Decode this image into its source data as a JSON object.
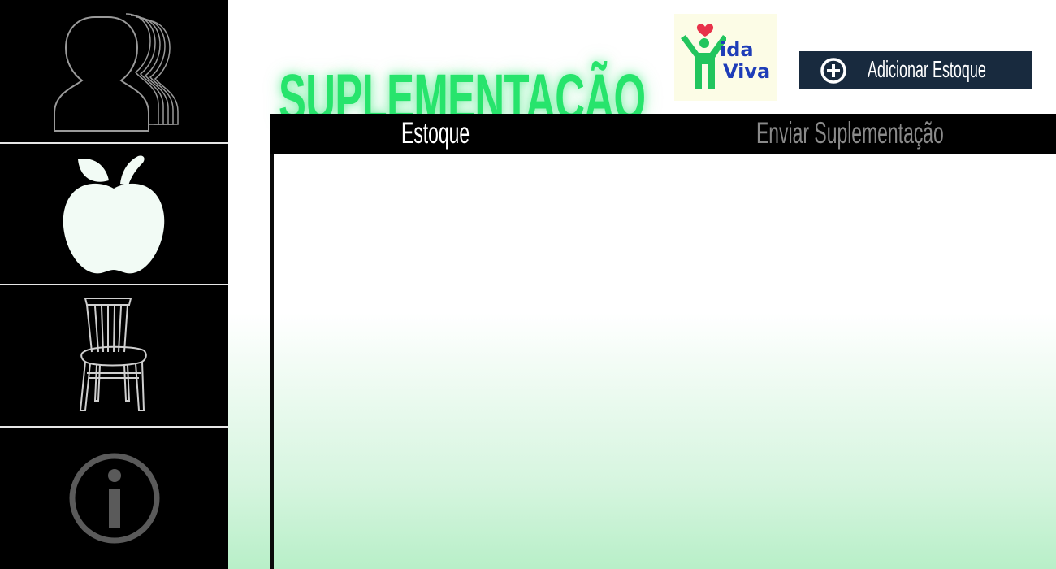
{
  "page": {
    "title": "SUPLEMENTAÇÃO",
    "title_color": "#27e46c"
  },
  "logo": {
    "word_top": "ida",
    "word_bottom": "Viva",
    "brand_color": "#1e3db8",
    "figure_color": "#22c55e",
    "heart_color": "#e8324a"
  },
  "sidebar": {
    "items": [
      {
        "icon": "users-icon"
      },
      {
        "icon": "apple-icon"
      },
      {
        "icon": "chair-icon"
      },
      {
        "icon": "info-icon"
      }
    ]
  },
  "toolbar": {
    "add_stock_label": "Adicionar Estoque",
    "add_stock_icon": "plus-circle-icon"
  },
  "tabs": [
    {
      "label": "Estoque",
      "active": true
    },
    {
      "label": "Enviar Suplementação",
      "active": false
    }
  ]
}
